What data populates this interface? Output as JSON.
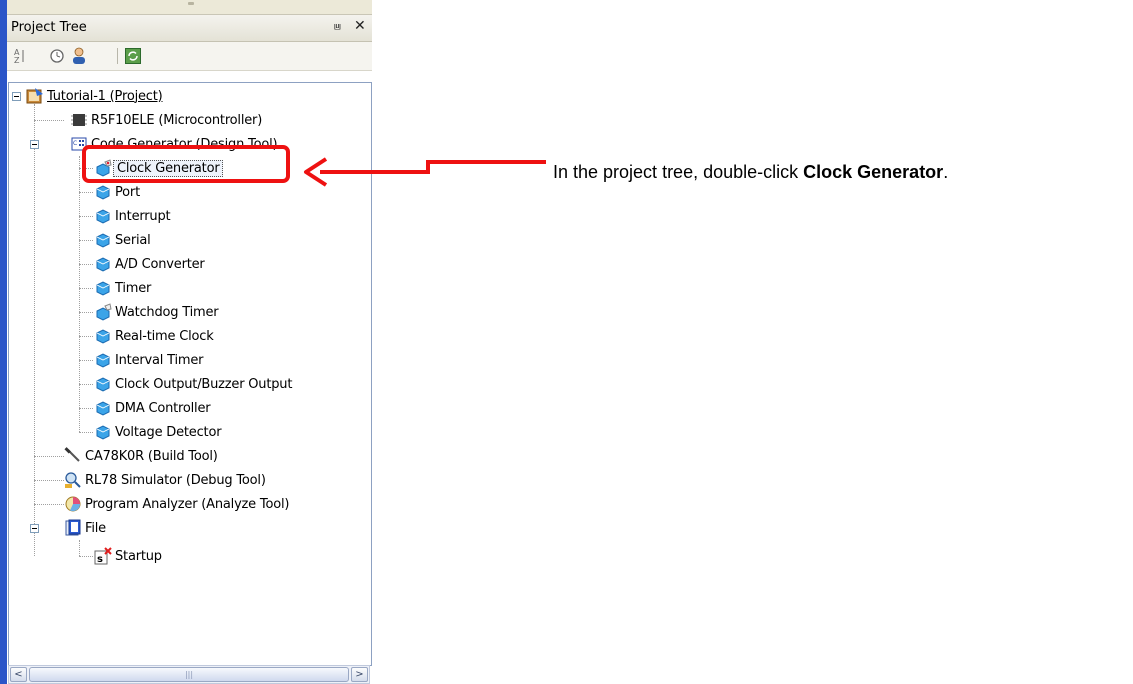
{
  "panel": {
    "title": "Project Tree",
    "pin_icon": "pin-icon",
    "close_icon": "close-icon",
    "toolbar": [
      "sort-icon",
      "history-icon",
      "user-icon",
      "refresh-icon"
    ]
  },
  "tree": {
    "project": "Tutorial-1 (Project)",
    "microcontroller": "R5F10ELE (Microcontroller)",
    "code_generator": "Code Generator (Design Tool)",
    "code_generator_children": [
      "Clock Generator",
      "Port",
      "Interrupt",
      "Serial",
      "A/D Converter",
      "Timer",
      "Watchdog Timer",
      "Real-time Clock",
      "Interval Timer",
      "Clock Output/Buzzer Output",
      "DMA Controller",
      "Voltage Detector"
    ],
    "build_tool": "CA78K0R (Build Tool)",
    "debug_tool": "RL78 Simulator (Debug Tool)",
    "analyze_tool": "Program Analyzer (Analyze Tool)",
    "file_folder": "File",
    "file_children": [
      "Startup"
    ]
  },
  "annotation": {
    "prefix": "In the project tree, double-click ",
    "bold": "Clock Generator",
    "suffix": ".",
    "color": "#ee1111"
  },
  "scrollbar": {
    "left_arrow": "<",
    "right_arrow": ">"
  }
}
